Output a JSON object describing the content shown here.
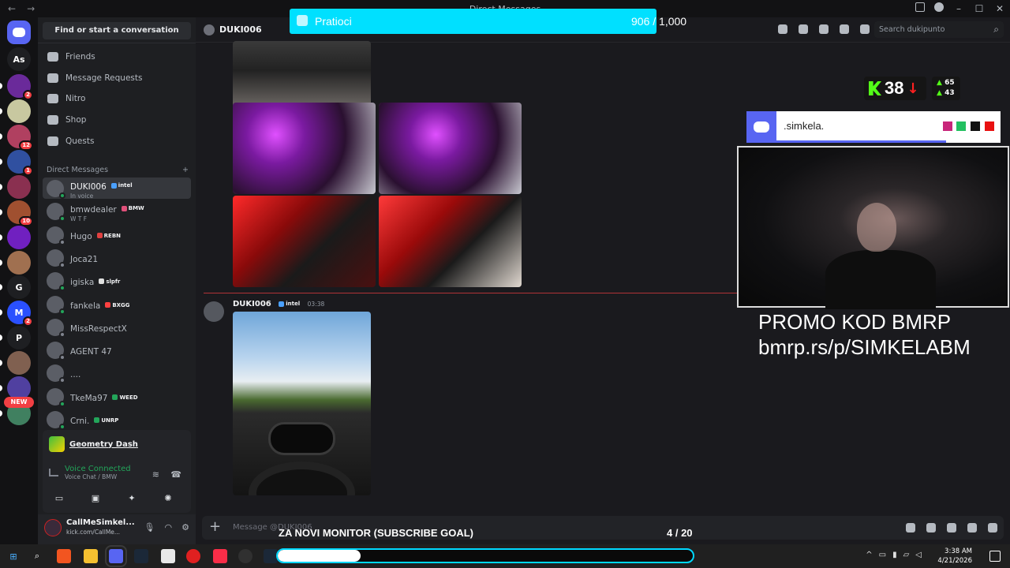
{
  "window": {
    "title": "Direct Messages"
  },
  "servers": {
    "items": [
      {
        "label": "",
        "color": "#5865f2",
        "badge": "",
        "top": 0
      },
      {
        "label": "As",
        "color": "#1e1f22",
        "badge": ""
      },
      {
        "label": "",
        "color": "#6a2a9a",
        "badge": "2"
      },
      {
        "label": "",
        "color": "#c8c8a0",
        "badge": ""
      },
      {
        "label": "",
        "color": "#b04060",
        "badge": "12"
      },
      {
        "label": "",
        "color": "#3050a0",
        "badge": "1"
      },
      {
        "label": "",
        "color": "#8a3050",
        "badge": ""
      },
      {
        "label": "",
        "color": "#a05030",
        "badge": "10"
      },
      {
        "label": "",
        "color": "#7020c0",
        "badge": ""
      },
      {
        "label": "",
        "color": "#a07050",
        "badge": ""
      },
      {
        "label": "G",
        "color": "#1e1f22",
        "badge": ""
      },
      {
        "label": "M",
        "color": "#2a50ff",
        "badge": "2"
      },
      {
        "label": "P",
        "color": "#1e1f22",
        "badge": ""
      },
      {
        "label": "",
        "color": "#806050",
        "badge": ""
      },
      {
        "label": "",
        "color": "#5040a0",
        "badge": ""
      },
      {
        "label": "",
        "color": "#408060",
        "badge": ""
      }
    ],
    "new_badge": "NEW"
  },
  "dm": {
    "search_placeholder": "Find or start a conversation",
    "nav": [
      "Friends",
      "Message Requests",
      "Nitro",
      "Shop",
      "Quests"
    ],
    "header": "Direct Messages",
    "header_add": "+",
    "items": [
      {
        "name": "DUKI006",
        "tag": "intel",
        "tag_color": "#4aa0ff",
        "sub": "In voice",
        "status": "on",
        "active": true
      },
      {
        "name": "bmwdealer",
        "tag": "BMW",
        "tag_color": "#e0507a",
        "sub": "W T F",
        "status": "on",
        "active": false
      },
      {
        "name": "Hugo",
        "tag": "REBN",
        "tag_color": "#e04040",
        "sub": "",
        "status": "off",
        "active": false
      },
      {
        "name": "Joca21",
        "tag": "",
        "tag_color": "",
        "sub": "",
        "status": "off",
        "active": false
      },
      {
        "name": "igiska",
        "tag": "slpfr",
        "tag_color": "#e0e0e0",
        "sub": "",
        "status": "on",
        "active": false
      },
      {
        "name": "fankela",
        "tag": "BXGG",
        "tag_color": "#ff4040",
        "sub": "",
        "status": "on",
        "active": false
      },
      {
        "name": "MissRespectX",
        "tag": "",
        "tag_color": "",
        "sub": "",
        "status": "off",
        "active": false
      },
      {
        "name": "AGENT 47",
        "tag": "",
        "tag_color": "",
        "sub": "",
        "status": "off",
        "active": false
      },
      {
        "name": "....",
        "tag": "",
        "tag_color": "",
        "sub": "",
        "status": "off",
        "active": false
      },
      {
        "name": "TkeMa97",
        "tag": "WEED",
        "tag_color": "#23a55a",
        "sub": "",
        "status": "on",
        "active": false
      },
      {
        "name": "Crni.",
        "tag": "UNRP",
        "tag_color": "#23a55a",
        "sub": "",
        "status": "on",
        "active": false
      }
    ]
  },
  "activity": {
    "game": "Geometry Dash",
    "voice_status": "Voice Connected",
    "voice_channel": "Voice Chat / BMW"
  },
  "user": {
    "name": "CallMeSimkel...",
    "status": "kick.com/CallMe..."
  },
  "chat": {
    "recipient": "DUKI006",
    "search_placeholder": "Search dukipunto",
    "message_author": "DUKI006",
    "message_tag": "intel",
    "message_time": "03:38",
    "composer_placeholder": "Message @DUKI006"
  },
  "overlay": {
    "followers_label": "Pratioci",
    "followers_count": "906 / 1,000",
    "followers_progress": 0.906,
    "kick_viewers": "38",
    "kick_up": "65",
    "kick_down": "43",
    "discord_name": ".simkela.",
    "swatches": [
      "#c8267a",
      "#23c060",
      "#111111",
      "#e81010"
    ],
    "promo_line1": "PROMO KOD BMRP",
    "promo_line2": "bmrp.rs/p/SIMKELABM",
    "goal_title": "ZA NOVI MONITOR (SUBSCRIBE GOAL)",
    "goal_count": "4 / 20",
    "goal_progress": 0.2
  },
  "taskbar": {
    "time": "3:38 AM",
    "date": "4/21/2026"
  }
}
